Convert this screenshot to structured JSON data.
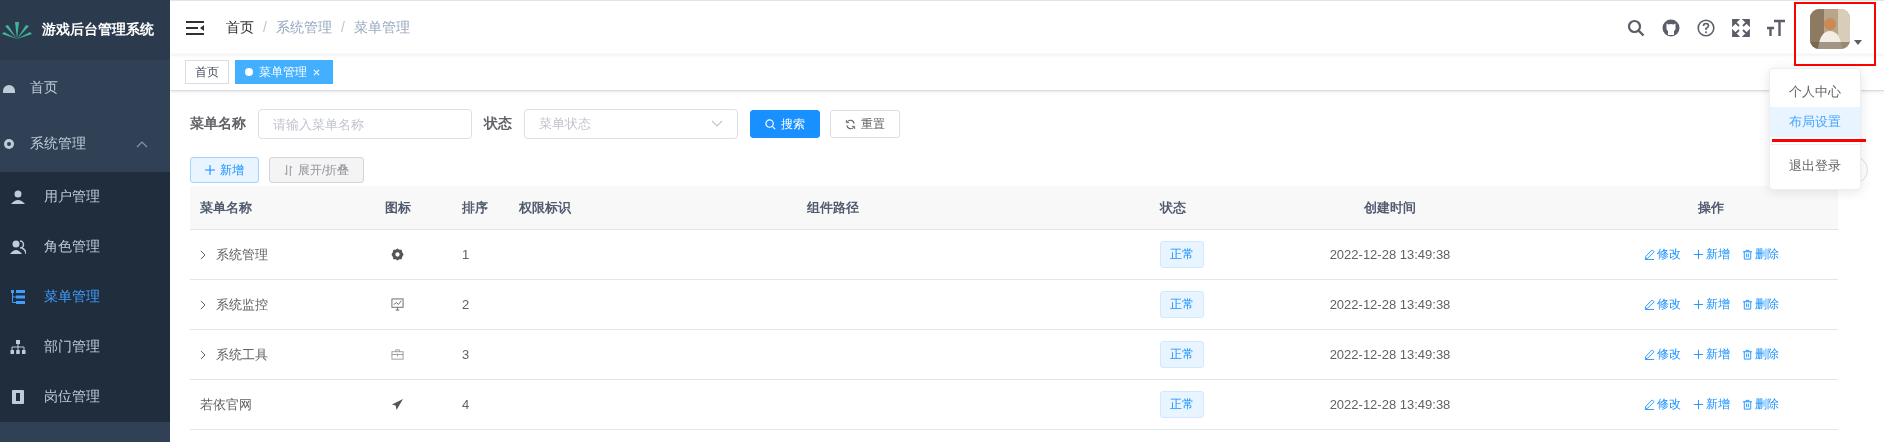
{
  "sidebar": {
    "title": "游戏后台管理系统",
    "items": [
      {
        "label": "首页",
        "selected": false
      },
      {
        "label": "系统管理",
        "selected": false,
        "expanded": true,
        "children": [
          {
            "label": "用户管理",
            "selected": false
          },
          {
            "label": "角色管理",
            "selected": false
          },
          {
            "label": "菜单管理",
            "selected": true
          },
          {
            "label": "部门管理",
            "selected": false
          },
          {
            "label": "岗位管理",
            "selected": false
          }
        ]
      }
    ]
  },
  "breadcrumb": {
    "separator": "/",
    "items": [
      {
        "label": "首页",
        "link": true
      },
      {
        "label": "系统管理",
        "link": false
      },
      {
        "label": "菜单管理",
        "link": false
      }
    ]
  },
  "tags": [
    {
      "label": "首页",
      "selected": false,
      "closable": false
    },
    {
      "label": "菜单管理",
      "selected": true,
      "closable": true
    }
  ],
  "search_form": {
    "fields": [
      {
        "label": "菜单名称",
        "placeholder": "请输入菜单名称",
        "kind": "input"
      },
      {
        "label": "状态",
        "placeholder": "菜单状态",
        "kind": "select"
      }
    ],
    "buttons": [
      {
        "label": "搜索",
        "kind": "primary"
      },
      {
        "label": "重置",
        "kind": "default"
      }
    ]
  },
  "toolbar": [
    {
      "label": "新增",
      "kind": "plain"
    },
    {
      "label": "展开/折叠",
      "kind": "info"
    }
  ],
  "table": {
    "columns": [
      "菜单名称",
      "图标",
      "排序",
      "权限标识",
      "组件路径",
      "状态",
      "创建时间",
      "操作"
    ],
    "rows": [
      {
        "name": "系统管理",
        "expandable": true,
        "order": "1",
        "status": "正常",
        "created": "2022-12-28 13:49:38",
        "actions": [
          "修改",
          "新增",
          "删除"
        ]
      },
      {
        "name": "系统监控",
        "expandable": true,
        "order": "2",
        "status": "正常",
        "created": "2022-12-28 13:49:38",
        "actions": [
          "修改",
          "新增",
          "删除"
        ]
      },
      {
        "name": "系统工具",
        "expandable": true,
        "order": "3",
        "status": "正常",
        "created": "2022-12-28 13:49:38",
        "actions": [
          "修改",
          "新增",
          "删除"
        ]
      },
      {
        "name": "若依官网",
        "expandable": false,
        "order": "4",
        "status": "正常",
        "created": "2022-12-28 13:49:38",
        "actions": [
          "修改",
          "新增",
          "删除"
        ]
      }
    ]
  },
  "user_menu": {
    "items": [
      {
        "label": "个人中心",
        "selected": false,
        "divided": false
      },
      {
        "label": "布局设置",
        "selected": true,
        "divided": false
      },
      {
        "label": "退出登录",
        "selected": false,
        "divided": true
      }
    ]
  }
}
